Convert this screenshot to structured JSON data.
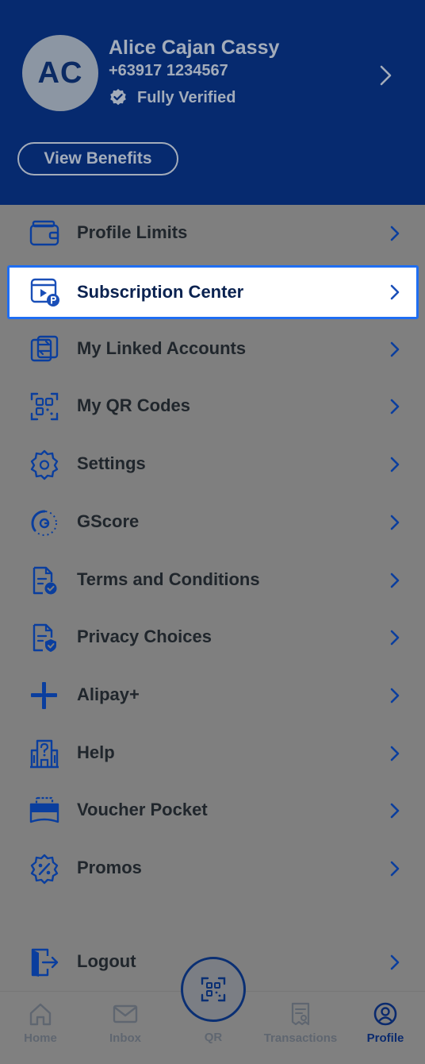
{
  "profile": {
    "initials": "AC",
    "name": "Alice Cajan Cassy",
    "phone": "+63917 1234567",
    "status": "Fully Verified",
    "benefits_label": "View Benefits"
  },
  "menu": {
    "items": [
      {
        "label": "Profile Limits",
        "icon": "wallet-icon"
      },
      {
        "label": "Subscription Center",
        "icon": "subscription-icon",
        "highlighted": true
      },
      {
        "label": "My Linked Accounts",
        "icon": "linked-accounts-icon"
      },
      {
        "label": "My QR Codes",
        "icon": "qr-code-icon"
      },
      {
        "label": "Settings",
        "icon": "gear-icon"
      },
      {
        "label": "GScore",
        "icon": "gscore-icon"
      },
      {
        "label": "Terms and Conditions",
        "icon": "document-check-icon"
      },
      {
        "label": "Privacy Choices",
        "icon": "document-shield-icon"
      },
      {
        "label": "Alipay+",
        "icon": "alipay-icon"
      },
      {
        "label": "Help",
        "icon": "help-building-icon"
      },
      {
        "label": "Voucher Pocket",
        "icon": "voucher-icon"
      },
      {
        "label": "Promos",
        "icon": "promo-badge-icon"
      }
    ],
    "logout_label": "Logout"
  },
  "bottom_nav": {
    "home": "Home",
    "inbox": "Inbox",
    "qr": "QR",
    "transactions": "Transactions",
    "profile": "Profile",
    "active": "profile"
  },
  "colors": {
    "header": "#062a6f",
    "overlay": "#7f7f7f",
    "highlight_border": "#1f6ef2",
    "icon_blue": "#0a3e9e"
  }
}
